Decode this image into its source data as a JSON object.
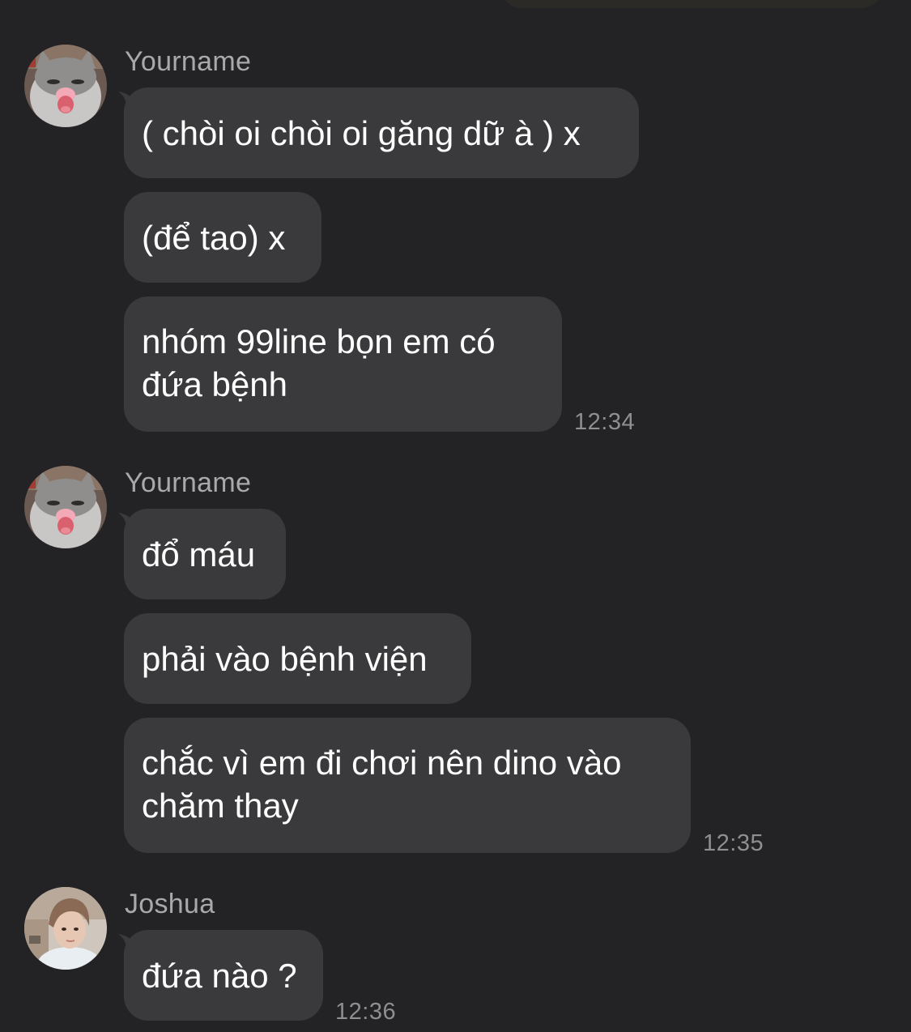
{
  "messages": [
    {
      "sender": "Yourname",
      "avatar_icon": "cat-avatar-icon",
      "bubbles": [
        "( chòi oi chòi oi găng dữ à ) x",
        "(để tao) x",
        {
          "line1": "nhóm 99line bọn em có",
          "line2": "đứa bệnh"
        }
      ],
      "time": "12:34"
    },
    {
      "sender": "Yourname",
      "avatar_icon": "cat-avatar-icon",
      "bubbles": [
        "đổ máu",
        "phải vào bệnh viện",
        {
          "line1": "chắc vì em đi chơi nên dino vào",
          "line2": "chăm thay"
        }
      ],
      "time": "12:35"
    },
    {
      "sender": "Joshua",
      "avatar_icon": "person-avatar-icon",
      "bubbles": [
        "đứa nào ?"
      ],
      "time": "12:36"
    }
  ],
  "colors": {
    "background": "#232325",
    "bubble": "#3a3a3c",
    "text": "#ffffff",
    "sender": "#a9a9ad",
    "time": "#8e8e93"
  }
}
